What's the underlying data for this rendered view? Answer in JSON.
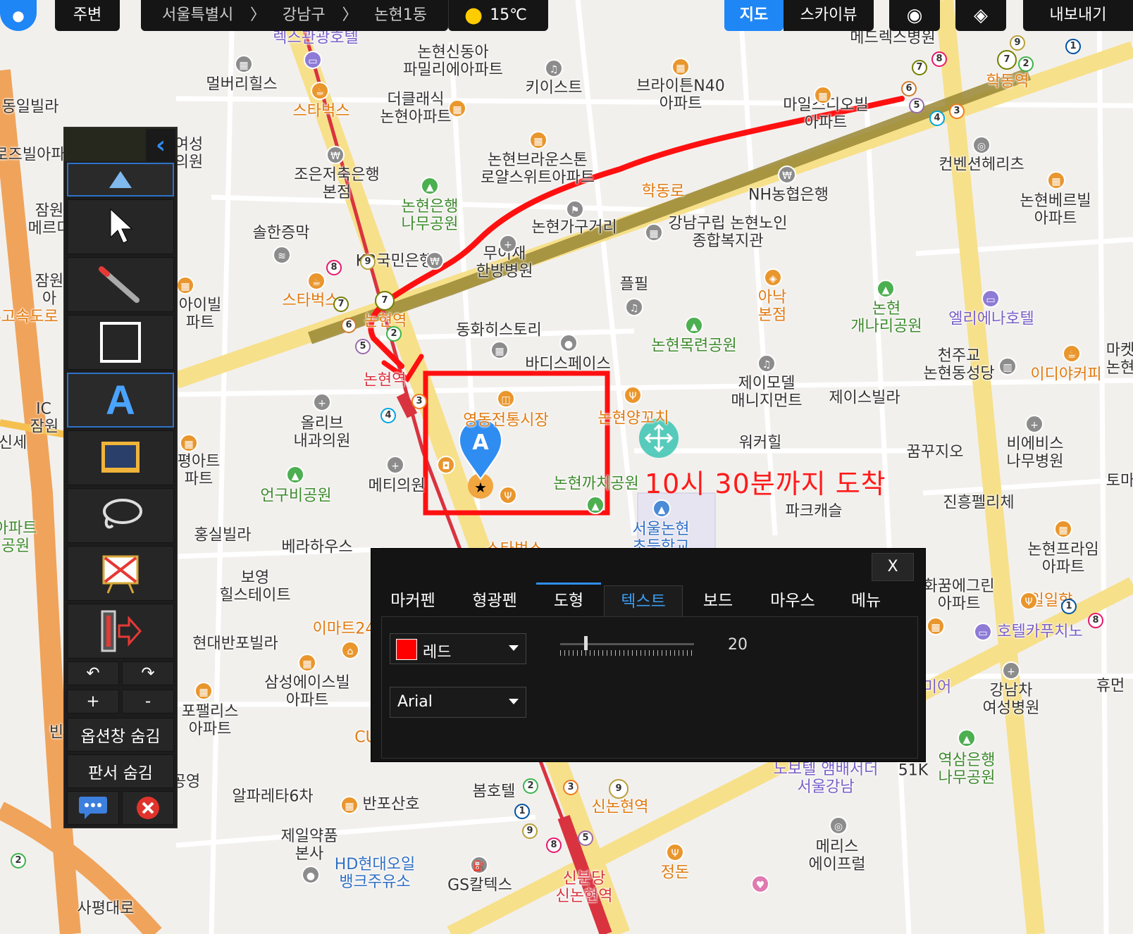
{
  "topbar": {
    "nearby": "주변",
    "breadcrumb": [
      "서울특별시",
      "강남구",
      "논현1동"
    ],
    "sep": "〉",
    "temperature": "15℃",
    "map_btn": "지도",
    "sky_btn": "스카이뷰",
    "export_btn": "내보내기"
  },
  "map": {
    "labels": [
      {
        "t": "렉스관광호텔",
        "c": "p"
      },
      {
        "t": "논현신동아\n파밀리에아파트",
        "c": ""
      },
      {
        "t": "멀버리힐스",
        "c": ""
      },
      {
        "t": "스타벅스",
        "c": "o"
      },
      {
        "t": "더클래식\n논현아파트",
        "c": ""
      },
      {
        "t": "키이스트",
        "c": ""
      },
      {
        "t": "브라이튼N40\n아파트",
        "c": ""
      },
      {
        "t": "메드렉스병원",
        "c": ""
      },
      {
        "t": "마일스디오빌\n아파트",
        "c": ""
      },
      {
        "t": "학동역",
        "c": "o"
      },
      {
        "t": "동일빌라",
        "c": ""
      },
      {
        "t": "로즈빌아파",
        "c": ""
      },
      {
        "t": "여성\n의원",
        "c": ""
      },
      {
        "t": "조은저축은행\n본점",
        "c": ""
      },
      {
        "t": "논현브라운스톤\n로얄스위트아파트",
        "c": ""
      },
      {
        "t": "NH농협은행",
        "c": ""
      },
      {
        "t": "컨벤션헤리츠",
        "c": ""
      },
      {
        "t": "학동로",
        "c": "o"
      },
      {
        "t": "논현은행\n나무공원",
        "c": "g"
      },
      {
        "t": "솔한증막",
        "c": ""
      },
      {
        "t": "논현가구거리",
        "c": ""
      },
      {
        "t": "강남구립 논현노인\n종합복지관",
        "c": ""
      },
      {
        "t": "논현베르빌\n아파트",
        "c": ""
      },
      {
        "t": "잠원\n메르디",
        "c": ""
      },
      {
        "t": "KB국민은행",
        "c": ""
      },
      {
        "t": "무이재\n한방병원",
        "c": ""
      },
      {
        "t": "플필",
        "c": ""
      },
      {
        "t": "아낙\n본점",
        "c": "o"
      },
      {
        "t": "논현\n개나리공원",
        "c": "g"
      },
      {
        "t": "엘리에나호텔",
        "c": "p"
      },
      {
        "t": "잠원\n아",
        "c": ""
      },
      {
        "t": "아이빌\n파트",
        "c": ""
      },
      {
        "t": "스타벅스",
        "c": "o"
      },
      {
        "t": "논현역",
        "c": "o"
      },
      {
        "t": "동화히스토리",
        "c": ""
      },
      {
        "t": "논현목련공원",
        "c": "g"
      },
      {
        "t": "천주교\n논현동성당",
        "c": ""
      },
      {
        "t": "이디야커피",
        "c": "o"
      },
      {
        "t": "바디스페이스",
        "c": ""
      },
      {
        "t": "제이모델\n매니지먼트",
        "c": ""
      },
      {
        "t": "제이스빌라",
        "c": ""
      },
      {
        "t": "논현역",
        "c": "r"
      },
      {
        "t": "영동전통시장",
        "c": "o"
      },
      {
        "t": "논현양꼬치",
        "c": "o"
      },
      {
        "t": "잠원",
        "c": ""
      },
      {
        "t": "올리브\n내과의원",
        "c": ""
      },
      {
        "t": "워커힐",
        "c": ""
      },
      {
        "t": "꿈꾸지오",
        "c": ""
      },
      {
        "t": "비에비스\n나무병원",
        "c": ""
      },
      {
        "t": "평아트\n파트",
        "c": ""
      },
      {
        "t": "메티의원",
        "c": ""
      },
      {
        "t": "논현까치공원",
        "c": "g"
      },
      {
        "t": "진흥펠리체",
        "c": ""
      },
      {
        "t": "언구비공원",
        "c": "g"
      },
      {
        "t": "파크캐슬",
        "c": ""
      },
      {
        "t": "홍실빌라",
        "c": ""
      },
      {
        "t": "베라하우스",
        "c": ""
      },
      {
        "t": "서울논현\n초등학교",
        "c": "b"
      },
      {
        "t": "논현프라임\n아파트",
        "c": ""
      },
      {
        "t": "보영\n힐스테이트",
        "c": ""
      },
      {
        "t": "현대반포빌라",
        "c": ""
      },
      {
        "t": "이마트24",
        "c": "o"
      },
      {
        "t": "삼성에이스빌\n아파트",
        "c": ""
      },
      {
        "t": "포팰리스\n아파트",
        "c": ""
      },
      {
        "t": "알파레타6차",
        "c": ""
      },
      {
        "t": "반포산호",
        "c": ""
      },
      {
        "t": "봄호텔",
        "c": ""
      },
      {
        "t": "신논현역",
        "c": "o"
      },
      {
        "t": "노보텔 앰배서더\n서울강남",
        "c": "p"
      },
      {
        "t": "51K",
        "c": ""
      },
      {
        "t": "역삼은행\n나무공원",
        "c": "g"
      },
      {
        "t": "강남차\n여성병원",
        "c": ""
      },
      {
        "t": "호텔카푸치노",
        "c": "p"
      },
      {
        "t": "화꿈에그린\n아파트",
        "c": ""
      },
      {
        "t": "일일향",
        "c": "o"
      },
      {
        "t": "제일약품\n본사",
        "c": ""
      },
      {
        "t": "HD현대오일\n뱅크주유소",
        "c": "b"
      },
      {
        "t": "GS칼텍스",
        "c": ""
      },
      {
        "t": "정돈",
        "c": "o"
      },
      {
        "t": "메리스\n에이프럴",
        "c": ""
      },
      {
        "t": "신분당\n신논현역",
        "c": "r"
      },
      {
        "t": "사평대로",
        "c": ""
      },
      {
        "t": "경부고속도로",
        "c": "o"
      },
      {
        "t": "IC",
        "c": ""
      },
      {
        "t": "신세",
        "c": ""
      },
      {
        "t": "공영",
        "c": ""
      },
      {
        "t": "CU",
        "c": "o"
      },
      {
        "t": "미어",
        "c": "p"
      },
      {
        "t": "휴먼",
        "c": ""
      },
      {
        "t": "토마",
        "c": ""
      },
      {
        "t": "아파트\n공원",
        "c": "g"
      },
      {
        "t": "빈",
        "c": ""
      },
      {
        "t": "마켓\n논현",
        "c": ""
      },
      {
        "t": "스타벅스",
        "c": "o"
      }
    ]
  },
  "annotation": {
    "marker_letter": "A",
    "text": "10시 30분까지 도착",
    "pen_color": "#ff0000"
  },
  "toolbox": {
    "undo": "↶",
    "redo": "↷",
    "zoom_in": "+",
    "zoom_out": "-",
    "hide_options": "옵션창 숨김",
    "hide_board": "판서 숨김"
  },
  "dialog": {
    "close": "X",
    "tabs": [
      "마커펜",
      "형광펜",
      "도형",
      "텍스트",
      "보드",
      "마우스",
      "메뉴"
    ],
    "active_tab": "텍스트",
    "color_value": "레드",
    "color_hex": "#ff0000",
    "font_value": "Arial",
    "size_value": "20"
  }
}
